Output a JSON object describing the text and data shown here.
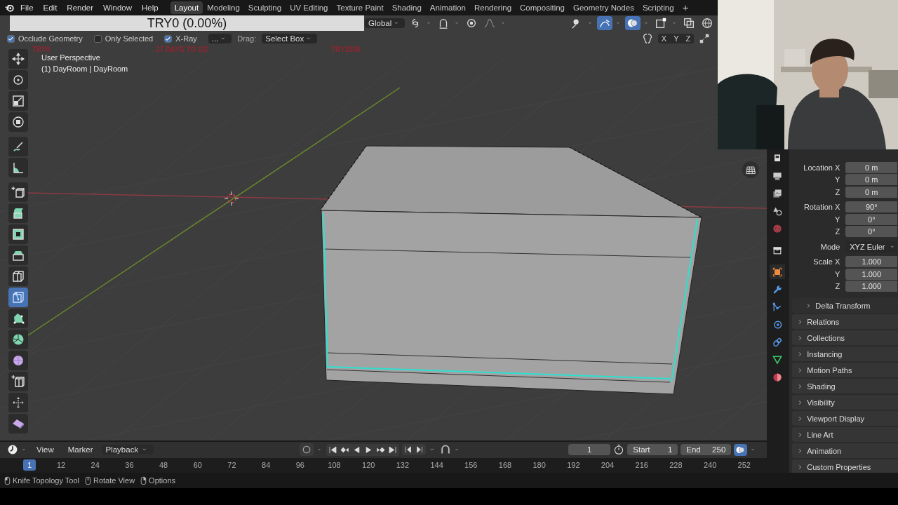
{
  "menu": [
    "File",
    "Edit",
    "Render",
    "Window",
    "Help"
  ],
  "workspaces": [
    {
      "label": "Layout",
      "selected": true
    },
    {
      "label": "Modeling",
      "selected": false
    },
    {
      "label": "Sculpting",
      "selected": false
    },
    {
      "label": "UV Editing",
      "selected": false
    },
    {
      "label": "Texture Paint",
      "selected": false
    },
    {
      "label": "Shading",
      "selected": false
    },
    {
      "label": "Animation",
      "selected": false
    },
    {
      "label": "Rendering",
      "selected": false
    },
    {
      "label": "Compositing",
      "selected": false
    },
    {
      "label": "Geometry Nodes",
      "selected": false
    },
    {
      "label": "Scripting",
      "selected": false
    }
  ],
  "add_workspace": "+",
  "banner": {
    "text": "TRY0 (0.00%)"
  },
  "overlay_notes": [
    "TRY0",
    "27 DAYS TO GO",
    "TRY2500"
  ],
  "viewport_header": {
    "orientation": "Global"
  },
  "options_bar": [
    {
      "kind": "checkbox",
      "label": "Occlude Geometry",
      "checked": true
    },
    {
      "kind": "checkbox",
      "label": "Only Selected",
      "checked": false
    },
    {
      "kind": "checkbox",
      "label": "X-Ray",
      "checked": true
    },
    {
      "kind": "dropdown",
      "label": "..."
    },
    {
      "kind": "label",
      "label": "Drag:"
    },
    {
      "kind": "dropdown",
      "label": "Select Box"
    }
  ],
  "mirror_axes": [
    "X",
    "Y",
    "Z"
  ],
  "viewport": {
    "view_name": "User Perspective",
    "object_info": "(1) DayRoom | DayRoom"
  },
  "tools": [
    {
      "kind": "move",
      "selected": false
    },
    {
      "kind": "rotate",
      "selected": false
    },
    {
      "kind": "scale",
      "selected": false
    },
    {
      "kind": "transform",
      "selected": false
    },
    {
      "kind": "annotate",
      "selected": false
    },
    {
      "kind": "measure",
      "selected": false
    },
    {
      "kind": "add_cube",
      "selected": false
    },
    {
      "kind": "extrude",
      "selected": false
    },
    {
      "kind": "inset",
      "selected": false
    },
    {
      "kind": "bevel",
      "selected": false
    },
    {
      "kind": "loop_cut",
      "selected": false
    },
    {
      "kind": "knife",
      "selected": true
    },
    {
      "kind": "poly_build",
      "selected": false
    },
    {
      "kind": "spin",
      "selected": false
    },
    {
      "kind": "smooth",
      "selected": false
    },
    {
      "kind": "edge_slide",
      "selected": false
    },
    {
      "kind": "shrink",
      "selected": false
    },
    {
      "kind": "shear",
      "selected": false
    }
  ],
  "property_tabs": [
    {
      "kind": "tool",
      "selected": false
    },
    {
      "kind": "render",
      "selected": false
    },
    {
      "kind": "view_layer",
      "selected": false
    },
    {
      "kind": "scene",
      "selected": false
    },
    {
      "kind": "world",
      "selected": false
    },
    {
      "kind": "collection",
      "selected": false
    },
    {
      "kind": "object",
      "selected": true
    },
    {
      "kind": "modifiers",
      "selected": false
    },
    {
      "kind": "particles",
      "selected": false
    },
    {
      "kind": "physics",
      "selected": false
    },
    {
      "kind": "constraints",
      "selected": false
    },
    {
      "kind": "data",
      "selected": false
    },
    {
      "kind": "material",
      "selected": false
    }
  ],
  "transform": [
    {
      "kind": "number",
      "label": "Location X",
      "value": "0 m"
    },
    {
      "kind": "number",
      "label": "Y",
      "value": "0 m"
    },
    {
      "kind": "number",
      "label": "Z",
      "value": "0 m"
    },
    {
      "kind": "number",
      "label": "Rotation X",
      "value": "90°"
    },
    {
      "kind": "number",
      "label": "Y",
      "value": "0°"
    },
    {
      "kind": "number",
      "label": "Z",
      "value": "0°"
    },
    {
      "kind": "dropdown",
      "label": "Mode",
      "value": "XYZ Euler"
    },
    {
      "kind": "number",
      "label": "Scale X",
      "value": "1.000"
    },
    {
      "kind": "number",
      "label": "Y",
      "value": "1.000"
    },
    {
      "kind": "number",
      "label": "Z",
      "value": "1.000"
    }
  ],
  "subpanels": [
    {
      "label": "Delta Transform",
      "expanded": false
    }
  ],
  "panels": [
    {
      "label": "Relations",
      "expanded": false
    },
    {
      "label": "Collections",
      "expanded": false
    },
    {
      "label": "Instancing",
      "expanded": false
    },
    {
      "label": "Motion Paths",
      "expanded": false
    },
    {
      "label": "Shading",
      "expanded": false
    },
    {
      "label": "Visibility",
      "expanded": false
    },
    {
      "label": "Viewport Display",
      "expanded": false
    },
    {
      "label": "Line Art",
      "expanded": false
    },
    {
      "label": "Animation",
      "expanded": false
    },
    {
      "label": "Custom Properties",
      "expanded": false
    }
  ],
  "timeline": {
    "menu": [
      "View",
      "Marker"
    ],
    "playback": "Playback",
    "current_frame": "1",
    "start": {
      "label": "Start",
      "value": "1"
    },
    "end": {
      "label": "End",
      "value": "250"
    },
    "ruler": [
      {
        "label": "1",
        "selected": true
      },
      {
        "label": "12",
        "selected": false
      },
      {
        "label": "24",
        "selected": false
      },
      {
        "label": "36",
        "selected": false
      },
      {
        "label": "48",
        "selected": false
      },
      {
        "label": "60",
        "selected": false
      },
      {
        "label": "72",
        "selected": false
      },
      {
        "label": "84",
        "selected": false
      },
      {
        "label": "96",
        "selected": false
      },
      {
        "label": "108",
        "selected": false
      },
      {
        "label": "120",
        "selected": false
      },
      {
        "label": "132",
        "selected": false
      },
      {
        "label": "144",
        "selected": false
      },
      {
        "label": "156",
        "selected": false
      },
      {
        "label": "168",
        "selected": false
      },
      {
        "label": "180",
        "selected": false
      },
      {
        "label": "192",
        "selected": false
      },
      {
        "label": "204",
        "selected": false
      },
      {
        "label": "216",
        "selected": false
      },
      {
        "label": "228",
        "selected": false
      },
      {
        "label": "240",
        "selected": false
      },
      {
        "label": "252",
        "selected": false
      }
    ]
  },
  "status_bar": [
    "Knife Topology Tool",
    "Rotate View",
    "Options"
  ],
  "webcam": {
    "kind": "picture"
  }
}
